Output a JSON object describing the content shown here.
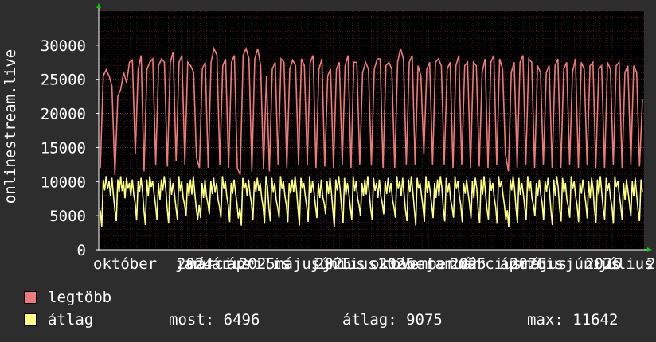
{
  "chart_data": {
    "type": "line",
    "ylabel": "onlinestream.live",
    "ylim": [
      0,
      35000
    ],
    "yticks": [
      0,
      5000,
      10000,
      15000,
      20000,
      25000,
      30000
    ],
    "x_tick_labels": [
      "október",
      "január",
      "2024",
      "március",
      "április",
      "2025",
      "május",
      "június",
      "2025",
      "július",
      "október",
      "2025",
      "november",
      "január",
      "2025",
      "március",
      "április",
      "2026",
      "május",
      "június",
      "2026",
      "július",
      "2"
    ],
    "grid": true,
    "background": "#000000",
    "series": [
      {
        "name": "legtöbb",
        "color": "#f07a7a",
        "values": [
          12000,
          25500,
          26400,
          25500,
          24000,
          11000,
          22500,
          23500,
          26000,
          24500,
          27500,
          27800,
          14000,
          26500,
          28500,
          11500,
          26500,
          27500,
          28000,
          12500,
          27000,
          28000,
          27500,
          12200,
          27500,
          29000,
          13000,
          27500,
          28500,
          12500,
          27500,
          27000,
          26000,
          13500,
          12000,
          26500,
          27500,
          12000,
          27500,
          29500,
          28500,
          12500,
          27000,
          28000,
          12000,
          27500,
          28500,
          12000,
          11000,
          28500,
          29500,
          28000,
          11500,
          28000,
          29500,
          27000,
          11800,
          25500,
          11500,
          26500,
          27500,
          12500,
          28000,
          27500,
          12000,
          26500,
          27800,
          27000,
          12500,
          28000,
          27000,
          12500,
          27500,
          28500,
          12000,
          26500,
          28000,
          12200,
          25500,
          26500,
          12000,
          26500,
          27500,
          12500,
          27000,
          28500,
          12000,
          27500,
          27500,
          12500,
          26000,
          27500,
          26500,
          12500,
          26500,
          28000,
          28000,
          12000,
          27000,
          27500,
          26500,
          12000,
          27500,
          29500,
          28000,
          12500,
          27500,
          28500,
          12500,
          27000,
          25500,
          14000,
          26500,
          27500,
          12500,
          27500,
          28000,
          27000,
          12500,
          26500,
          27500,
          12000,
          27000,
          28500,
          12500,
          27000,
          27500,
          12000,
          27500,
          27000,
          12200,
          26000,
          28000,
          12000,
          27500,
          28500,
          12500,
          28000,
          26500,
          14000,
          11500,
          26000,
          27500,
          12000,
          27500,
          28500,
          12500,
          28000,
          27500,
          12000,
          27000,
          26000,
          12500,
          26000,
          27000,
          12000,
          27000,
          28000,
          12000,
          26500,
          27500,
          12500,
          26000,
          28000,
          12000,
          27500,
          26500,
          12500,
          27000,
          27500,
          12000,
          26500,
          27000,
          12000,
          27500,
          26500,
          12500,
          27000,
          27500,
          12000,
          26000,
          27000,
          12500,
          27000,
          26000,
          12200,
          22000
        ],
        "lows_note": "",
        "keypoints": []
      },
      {
        "name": "átlag",
        "color": "#ffff80",
        "values": []
      }
    ],
    "legend": {
      "stats": {
        "most_label": "most:",
        "most": "6496",
        "avg_label": "átlag:",
        "avg": "9075",
        "max_label": "max:",
        "max": "11642"
      }
    }
  }
}
